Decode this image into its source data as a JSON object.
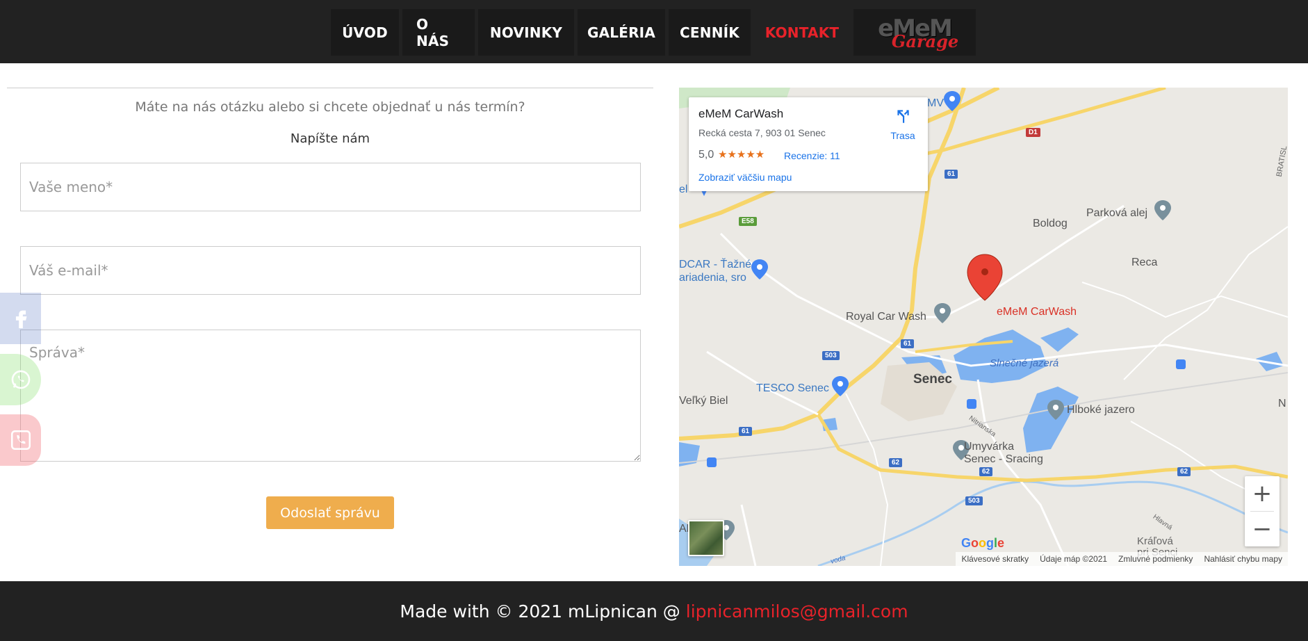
{
  "nav": {
    "items": [
      "ÚVOD",
      "O NÁS",
      "NOVINKY",
      "GALÉRIA",
      "CENNÍK",
      "KONTAKT"
    ],
    "active": "KONTAKT",
    "logo": {
      "line1": "eMeM",
      "line2": "Garage"
    }
  },
  "form": {
    "question": "Máte na nás otázku alebo si chcete objednať u nás termín?",
    "heading": "Napíšte nám",
    "name_placeholder": "Vaše meno*",
    "email_placeholder": "Váš e-mail*",
    "message_placeholder": "Správa*",
    "submit_label": "Odoslať správu"
  },
  "social": {
    "icons": [
      "facebook-icon",
      "whatsapp-icon",
      "phone-icon"
    ]
  },
  "map": {
    "info": {
      "name": "eMeM CarWash",
      "address": "Recká cesta 7, 903 01 Senec",
      "rating": "5,0",
      "stars": "★★★★★",
      "reviews": "Recenzie: 11",
      "bigger_map": "Zobraziť väčšiu mapu",
      "directions": "Trasa"
    },
    "labels": {
      "marker": "eMeM CarWash",
      "royal": "Royal Car Wash",
      "tesco": "TESCO Senec",
      "senec": "Senec",
      "boldog": "Boldog",
      "parkova": "Parková alej",
      "reca": "Reca",
      "slnecne": "Slnečné jazerá",
      "hlboke": "Hlboké jazero",
      "umyvarka1": "Umyvárka",
      "umyvarka2": "Senec - Sracing",
      "velky_biel": "Veľký Biel",
      "docar1": "DCAR - Ťažné",
      "docar2": "ariadenia, sro",
      "kralova1": "Kráľová",
      "kralova2": "pri Senci",
      "mv": "MV",
      "el": "el",
      "ak": "AK",
      "n": "N",
      "bratisl": "BRATISL",
      "nitrianska": "Nitrianska",
      "hlava": "Hlavná",
      "voda": "voda"
    },
    "shields": [
      "D1",
      "61",
      "E58",
      "61",
      "503",
      "61",
      "62",
      "62",
      "503",
      "62"
    ],
    "google": [
      "G",
      "o",
      "o",
      "g",
      "l",
      "e"
    ],
    "attribution": [
      "Klávesové skratky",
      "Údaje máp ©2021",
      "Zmluvné podmienky",
      "Nahlásiť chybu mapy"
    ],
    "zoom_in": "+",
    "zoom_out": "−"
  },
  "footer": {
    "text": "Made with © 2021 mLipnican @",
    "email": "lipnicanmilos@gmail.com"
  }
}
